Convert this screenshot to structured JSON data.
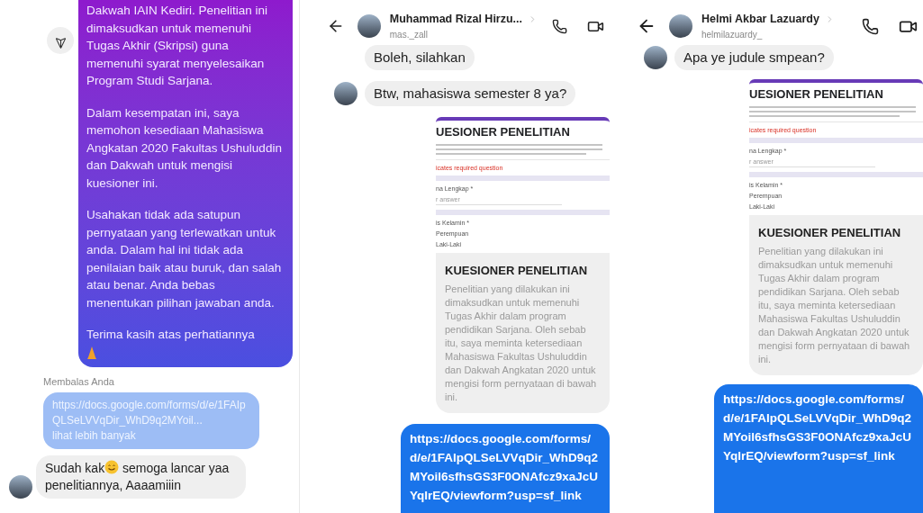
{
  "panels": [
    {
      "messages": [
        {
          "kind": "gradient_outgoing",
          "share_button": true,
          "paragraphs": [
            "Dakwah IAIN Kediri. Penelitian ini dimaksudkan untuk memenuhi Tugas Akhir (Skripsi) guna memenuhi syarat menyelesaikan Program Studi Sarjana.",
            "Dalam kesempatan ini, saya memohon kesediaan Mahasiswa Angkatan 2020 Fakultas Ushuluddin dan Dakwah untuk mengisi kuesioner ini.",
            "Usahakan tidak ada satupun pernyataan yang terlewatkan untuk anda. Dalam hal ini tidak ada penilaian baik atau buruk, dan salah atau benar. Anda bebas menentukan pilihan jawaban anda.",
            "Terima kasih atas perhatiannya"
          ]
        },
        {
          "kind": "reply_label",
          "text": "Membalas Anda"
        },
        {
          "kind": "quoted",
          "text": "https://docs.google.com/forms/d/e/1FAIpQLSeLVVqDir_WhD9q2MYoil...",
          "more": "lihat lebih banyak"
        },
        {
          "kind": "incoming_emoji",
          "avatar": true,
          "text_before": "Sudah kak",
          "text_after": "semoga lancar yaa penelitiannya, Aaaamiiin"
        }
      ]
    },
    {
      "header": {
        "name": "Muhammad Rizal Hirzu...",
        "username": "mas._zall"
      },
      "messages": [
        {
          "kind": "incoming",
          "avatar": false,
          "text": "Boleh, silahkan"
        },
        {
          "kind": "incoming",
          "avatar": true,
          "text": "Btw, mahasiswa semester 8 ya?"
        },
        {
          "kind": "form_preview",
          "title": "UESIONER PENELITIAN",
          "required_note": "icates required question",
          "fields": [
            {
              "kind": "text",
              "label": "na Lengkap *",
              "placeholder": "r answer"
            },
            {
              "kind": "radio",
              "label": "is Kelamin *",
              "options": [
                "Perempuan",
                "Laki-Laki"
              ]
            }
          ],
          "card_title": "KUESIONER PENELITIAN",
          "card_text": "Penelitian yang dilakukan ini dimaksudkan untuk memenuhi Tugas Akhir dalam program pendidikan Sarjana. Oleh sebab itu, saya meminta ketersediaan Mahasiswa Fakultas Ushuluddin dan Dakwah Angkatan 2020 untuk mengisi form pernyataan di bawah ini."
        },
        {
          "kind": "link",
          "text": "https://docs.google.com/forms/d/e/1FAIpQLSeLVVqDir_WhD9q2MYoil6sfhsGS3F0ONAfcz9xaJcUYqIrEQ/viewform?usp=sf_link"
        }
      ]
    },
    {
      "header": {
        "name": "Helmi Akbar Lazuardy",
        "username": "helmilazuardy_"
      },
      "messages": [
        {
          "kind": "incoming",
          "avatar": true,
          "text": "Apa ye judule smpean?"
        },
        {
          "kind": "form_preview",
          "title": "UESIONER PENELITIAN",
          "required_note": "icates required question",
          "fields": [
            {
              "kind": "text",
              "label": "na Lengkap *",
              "placeholder": "r answer"
            },
            {
              "kind": "radio",
              "label": "is Kelamin *",
              "options": [
                "Perempuan",
                "Laki-Laki"
              ]
            }
          ],
          "card_title": "KUESIONER PENELITIAN",
          "card_text": "Penelitian yang dilakukan ini dimaksudkan untuk memenuhi Tugas Akhir dalam program pendidikan Sarjana. Oleh sebab itu, saya meminta ketersediaan Mahasiswa Fakultas Ushuluddin dan Dakwah Angkatan 2020 untuk mengisi form pernyataan di bawah ini."
        },
        {
          "kind": "link",
          "text": "https://docs.google.com/forms/d/e/1FAIpQLSeLVVqDir_WhD9q2MYoil6sfhsGS3F0ONAfcz9xaJcUYqIrEQ/viewform?usp=sf_link"
        }
      ]
    }
  ]
}
